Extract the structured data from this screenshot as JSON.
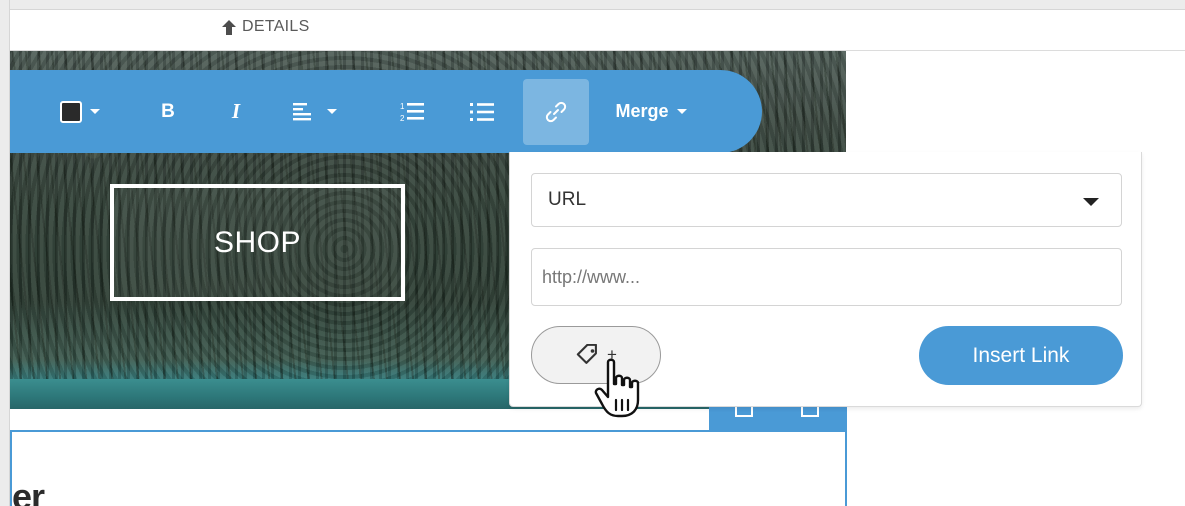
{
  "header": {
    "details_label": "DETAILS"
  },
  "toolbar": {
    "color_value": "#2a2a2a",
    "bold_label": "B",
    "italic_label": "I",
    "merge_label": "Merge"
  },
  "canvas": {
    "shop_label": "SHOP",
    "partial_heading": "er"
  },
  "link_popup": {
    "type_selected": "URL",
    "url_placeholder": "http://www...",
    "tag_plus": "+",
    "insert_label": "Insert Link"
  },
  "colors": {
    "accent": "#4a9ad6",
    "text": "#333333"
  },
  "icons": [
    "up-arrow-icon",
    "text-color-icon",
    "bold-icon",
    "italic-icon",
    "align-left-icon",
    "ordered-list-icon",
    "unordered-list-icon",
    "link-icon",
    "tag-icon",
    "hand-cursor-icon"
  ]
}
